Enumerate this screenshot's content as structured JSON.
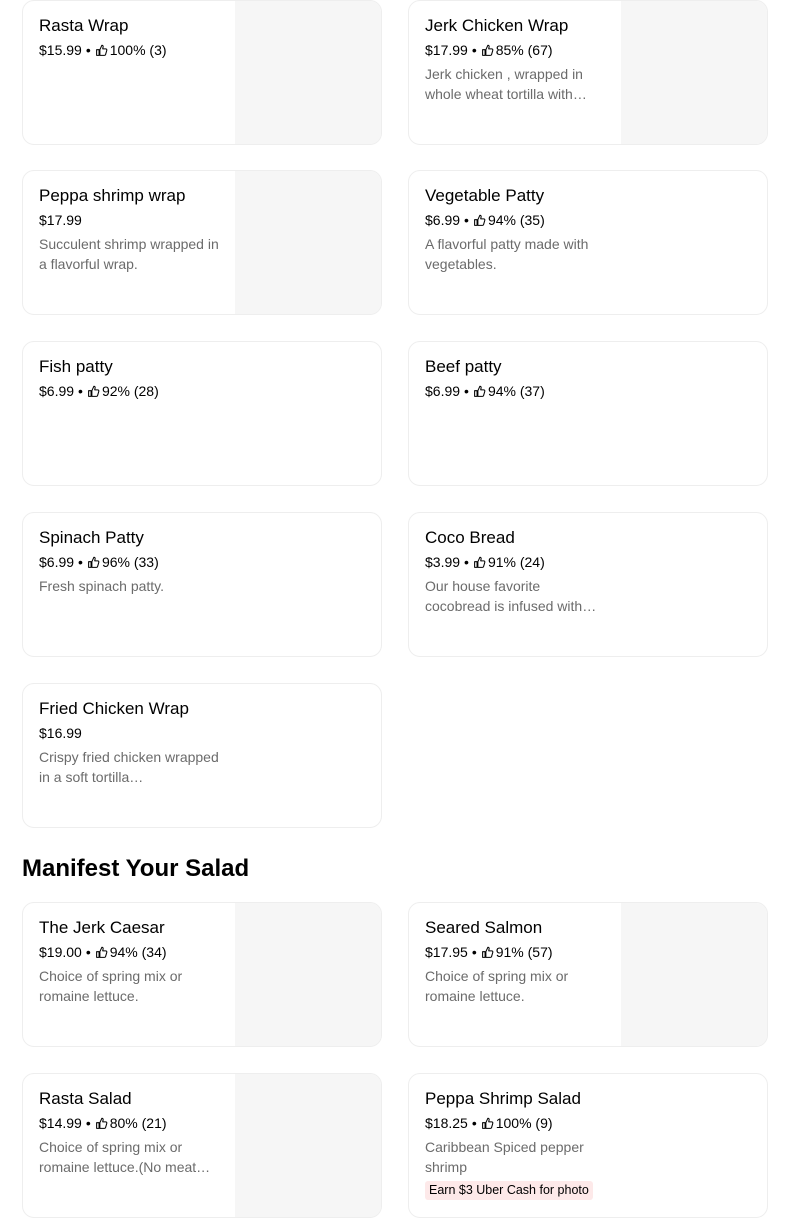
{
  "items": [
    {
      "name": "Rasta Wrap",
      "price": "$15.99",
      "rating": "100% (3)",
      "desc": "",
      "image": true
    },
    {
      "name": "Jerk Chicken Wrap",
      "price": "$17.99",
      "rating": "85% (67)",
      "desc": "Jerk chicken , wrapped in whole wheat tortilla with…",
      "image": true
    },
    {
      "name": "Peppa shrimp wrap",
      "price": "$17.99",
      "rating": "",
      "desc": "Succulent shrimp wrapped in a flavorful wrap.",
      "image": true
    },
    {
      "name": "Vegetable Patty",
      "price": "$6.99",
      "rating": "94% (35)",
      "desc": "A flavorful patty made with vegetables.",
      "image": false
    },
    {
      "name": "Fish patty",
      "price": "$6.99",
      "rating": "92% (28)",
      "desc": "",
      "image": false
    },
    {
      "name": "Beef patty",
      "price": "$6.99",
      "rating": "94% (37)",
      "desc": "",
      "image": false
    },
    {
      "name": "Spinach Patty",
      "price": "$6.99",
      "rating": "96% (33)",
      "desc": "Fresh spinach patty.",
      "image": false
    },
    {
      "name": "Coco Bread",
      "price": "$3.99",
      "rating": "91% (24)",
      "desc": "Our house favorite cocobread is infused with…",
      "image": false
    },
    {
      "name": "Fried Chicken Wrap",
      "price": "$16.99",
      "rating": "",
      "desc": "Crispy fried chicken wrapped in a soft tortilla…",
      "image": false
    }
  ],
  "salad_section": {
    "title": "Manifest Your Salad",
    "items": [
      {
        "name": "The Jerk Caesar",
        "price": "$19.00",
        "rating": "94% (34)",
        "desc": "Choice of spring mix or romaine lettuce.",
        "image": true
      },
      {
        "name": "Seared Salmon",
        "price": "$17.95",
        "rating": "91% (57)",
        "desc": "Choice of spring mix or romaine lettuce.",
        "image": true
      },
      {
        "name": "Rasta Salad",
        "price": "$14.99",
        "rating": "80% (21)",
        "desc": "Choice of spring mix or romaine lettuce.(No meat…",
        "image": true
      },
      {
        "name": "Peppa Shrimp Salad",
        "price": "$18.25",
        "rating": "100% (9)",
        "desc": "Caribbean Spiced pepper shrimp",
        "badge": "Earn $3 Uber Cash for photo",
        "image": false
      }
    ]
  },
  "colors": {
    "badge_bg": "#fde9e9",
    "image_placeholder": "#f6f6f6",
    "muted_text": "#6b6b6b",
    "border": "#eeeeee"
  },
  "icons": {
    "rating": "thumbs-up-icon",
    "separator": "•"
  }
}
